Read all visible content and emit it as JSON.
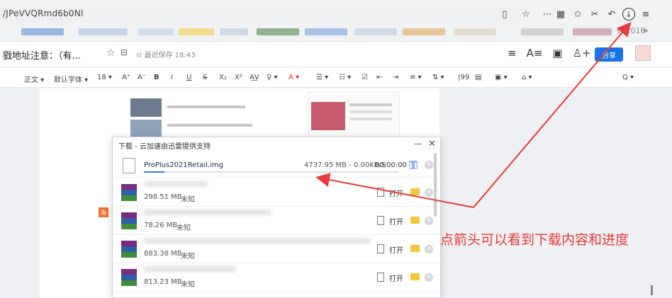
{
  "browser": {
    "url_text": "/JPeVVQRmd6b0NI",
    "bookmark_tail": "sa2016",
    "bookmark_more": "»"
  },
  "doc": {
    "title": "戥地址注意：（有...",
    "saved": "最近保存 18:43",
    "share_label": "分享"
  },
  "toolbar": {
    "items": [
      "正文 ▾",
      "默认字体 ▾",
      "18 ▾",
      "A⁺",
      "A⁻",
      "B",
      "I",
      "U",
      "S",
      "X₂",
      "X²",
      "A͟V",
      "♀ ▾",
      "A ▾",
      "☰ ▾",
      "☷ ▾",
      "☑",
      "⇤",
      "⇥",
      "≡ ▾",
      "⇅ ▾",
      "|99",
      "▤",
      "▣ ▾",
      "⌂ ▾",
      "Q ▾"
    ]
  },
  "download": {
    "title": "下载 - 云加速由迅雷提供支持",
    "active": {
      "name": "ProPlus2021Retail.img",
      "stats": "4737.95 MB - 0.00KB/S",
      "time": "00:00:00",
      "progress": 0.08
    },
    "items": [
      {
        "size": "298.51 MB",
        "status": "未知",
        "open": "打开"
      },
      {
        "size": "78.26 MB",
        "status": "未知",
        "open": "打开"
      },
      {
        "size": "883.38 MB",
        "status": "未知",
        "open": "打开"
      },
      {
        "size": "813.23 MB",
        "status": "未知",
        "open": "打开"
      }
    ]
  },
  "annotation": {
    "text": "点箭头可以看到下载内容和进度",
    "color": "#e83a3a"
  }
}
